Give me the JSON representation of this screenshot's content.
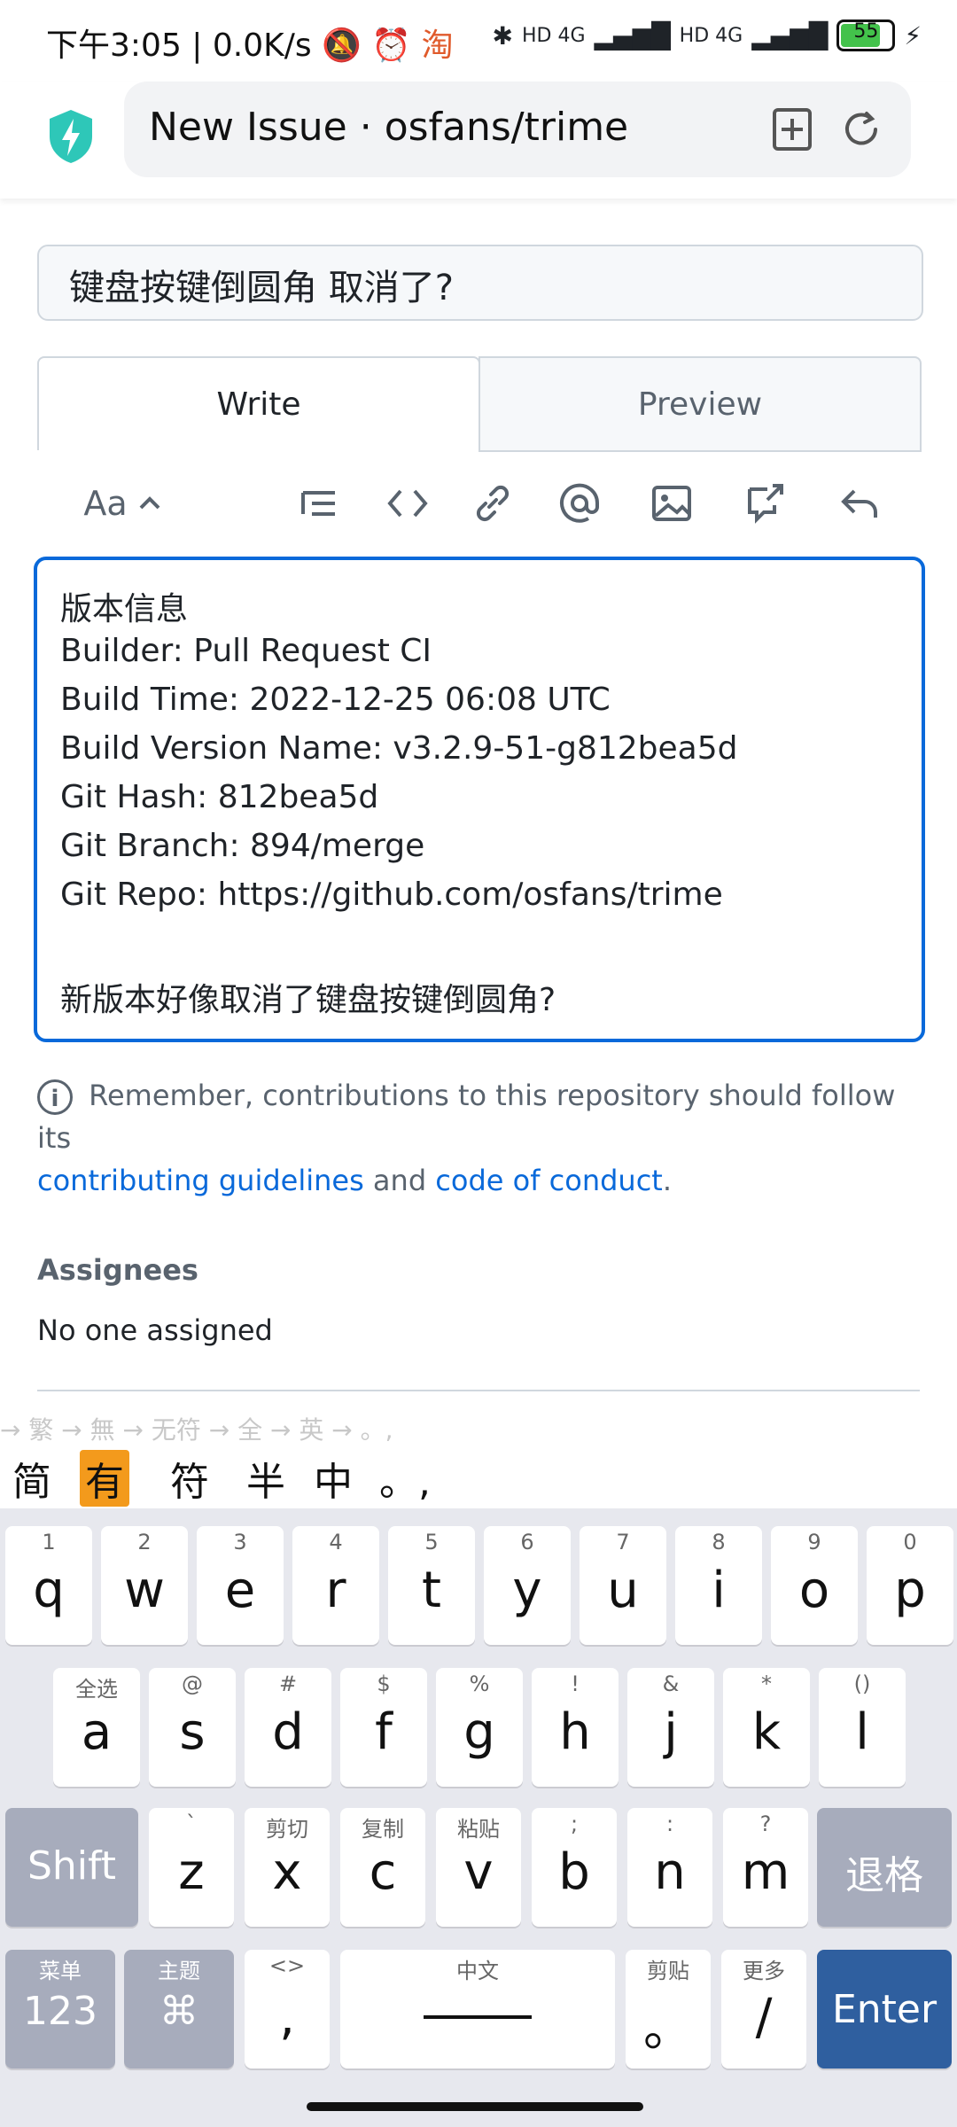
{
  "status_bar": {
    "time": "下午3:05",
    "speed": "0.0K/s",
    "network_1": "HD 4G",
    "network_2": "HD 4G",
    "battery": "55"
  },
  "browser": {
    "tab_title": "New Issue · osfans/trime"
  },
  "issue": {
    "title_value": "键盘按键倒圆角 取消了?",
    "tabs": {
      "write": "Write",
      "preview": "Preview"
    },
    "toolbar": {
      "heading": "Aa"
    },
    "body_lines": [
      "版本信息",
      "Builder: Pull Request CI",
      "Build Time: 2022-12-25 06:08 UTC",
      "Build Version Name: v3.2.9-51-g812bea5d",
      "Git Hash: 812bea5d",
      "Git Branch: 894/merge",
      "Git Repo: https://github.com/osfans/trime",
      "",
      "新版本好像取消了键盘按键倒圆角?"
    ],
    "note_prefix": "Remember, contributions to this repository should follow its",
    "note_link1": "contributing guidelines",
    "note_and": "and",
    "note_link2": "code of conduct",
    "note_suffix": ".",
    "assignees_heading": "Assignees",
    "assignees_value": "No one assigned"
  },
  "ime": {
    "hint": "→ 繁 → 無 → 无符 → 全 → 英 → 。,",
    "candidates": [
      "简",
      "有",
      "符",
      "半",
      "中",
      "。,"
    ]
  },
  "keyboard": {
    "row1": [
      {
        "main": "q",
        "sub": "1"
      },
      {
        "main": "w",
        "sub": "2"
      },
      {
        "main": "e",
        "sub": "3"
      },
      {
        "main": "r",
        "sub": "4"
      },
      {
        "main": "t",
        "sub": "5"
      },
      {
        "main": "y",
        "sub": "6"
      },
      {
        "main": "u",
        "sub": "7"
      },
      {
        "main": "i",
        "sub": "8"
      },
      {
        "main": "o",
        "sub": "9"
      },
      {
        "main": "p",
        "sub": "0"
      }
    ],
    "row2": [
      {
        "main": "a",
        "sub": "全选"
      },
      {
        "main": "s",
        "sub": "@"
      },
      {
        "main": "d",
        "sub": "#"
      },
      {
        "main": "f",
        "sub": "$"
      },
      {
        "main": "g",
        "sub": "%"
      },
      {
        "main": "h",
        "sub": "!"
      },
      {
        "main": "j",
        "sub": "&"
      },
      {
        "main": "k",
        "sub": "*"
      },
      {
        "main": "l",
        "sub": "()"
      }
    ],
    "row3": [
      {
        "main": "z",
        "sub": "`"
      },
      {
        "main": "x",
        "sub": "剪切"
      },
      {
        "main": "c",
        "sub": "复制"
      },
      {
        "main": "v",
        "sub": "粘贴"
      },
      {
        "main": "b",
        "sub": ";"
      },
      {
        "main": "n",
        "sub": ":"
      },
      {
        "main": "m",
        "sub": "?"
      }
    ],
    "shift": "Shift",
    "backspace": "退格",
    "k123_sub": "菜单",
    "k123": "123",
    "theme_sub": "主题",
    "theme": "⌘",
    "comma_sub": "<>",
    "comma": ",",
    "space_sub": "中文",
    "period_sub": "剪贴",
    "period": "。",
    "slash_sub": "更多",
    "slash": "/",
    "enter": "Enter"
  }
}
